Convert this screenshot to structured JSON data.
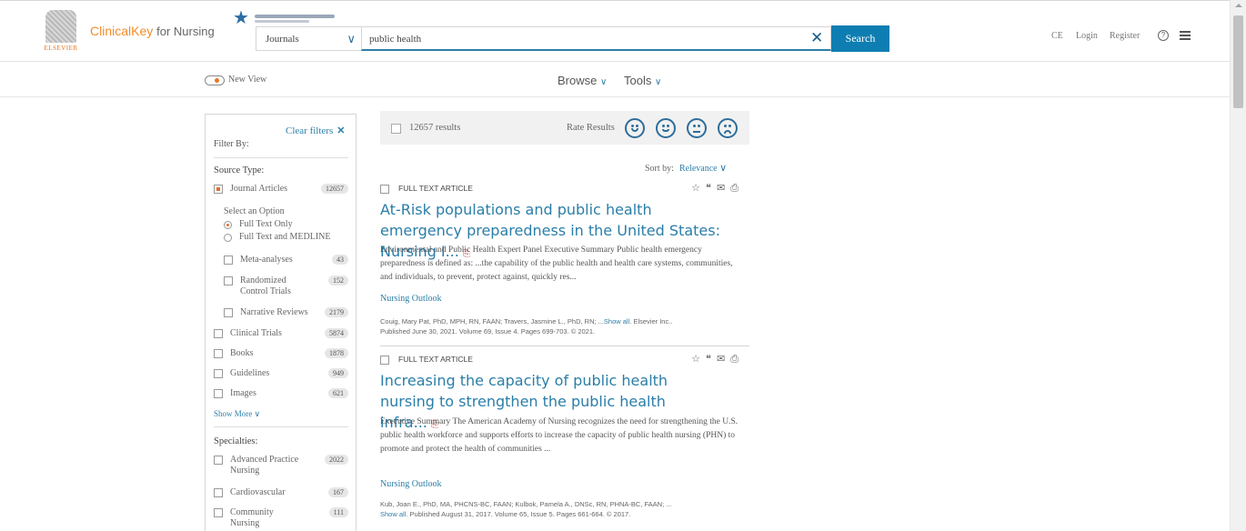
{
  "header": {
    "logo_text": "ELSEVIER",
    "brand_primary": "ClinicalKey",
    "brand_secondary": "for Nursing",
    "search_scope": "Journals",
    "search_query": "public health",
    "search_button": "Search",
    "nav": {
      "ce": "CE",
      "login": "Login",
      "register": "Register"
    }
  },
  "subnav": {
    "new_view": "New View",
    "browse": "Browse",
    "tools": "Tools"
  },
  "filters": {
    "clear_filters": "Clear filters",
    "filter_by": "Filter By:",
    "source_type_title": "Source Type:",
    "journal_articles": {
      "label": "Journal Articles",
      "count": "12657"
    },
    "select_option": "Select an Option",
    "full_text_only": "Full Text Only",
    "full_text_medline": "Full Text and MEDLINE",
    "sub_types": [
      {
        "label": "Meta-analyses",
        "count": "43"
      },
      {
        "label": "Randomized Control Trials",
        "count": "152"
      },
      {
        "label": "Narrative Reviews",
        "count": "2179"
      }
    ],
    "other_types": [
      {
        "label": "Clinical Trials",
        "count": "5874"
      },
      {
        "label": "Books",
        "count": "1878"
      },
      {
        "label": "Guidelines",
        "count": "949"
      },
      {
        "label": "Images",
        "count": "621"
      }
    ],
    "show_more": "Show More",
    "specialties_title": "Specialties:",
    "specialties": [
      {
        "label": "Advanced Practice Nursing",
        "count": "2022"
      },
      {
        "label": "Cardiovascular",
        "count": "167"
      },
      {
        "label": "Community Nursing",
        "count": "111"
      }
    ]
  },
  "results": {
    "count_text": "12657 results",
    "rate_results": "Rate Results",
    "sort_by": "Sort by:",
    "sort_value": "Relevance",
    "articles": [
      {
        "type": "FULL TEXT ARTICLE",
        "title": "At-Risk populations and public health emergency preparedness in the United States: Nursing I...",
        "abstract": "Environmental and Public Health Expert Panel Executive Summary Public health emergency preparedness is defined as: ...the capability of the public health and health care systems, communities, and individuals, to prevent, protect against, quickly res...",
        "journal": "Nursing Outlook",
        "authors": "Couig, Mary Pat, PhD, MPH, RN, FAAN; Travers, Jasmine L., PhD, RN; ...",
        "show_all": "Show all.",
        "pub_info": "Published June 30, 2021. Volume 69, Issue 4. Pages 699-703. © 2021.",
        "publisher": "Elsevier Inc.."
      },
      {
        "type": "FULL TEXT ARTICLE",
        "title": "Increasing the capacity of public health nursing to strengthen the public health infra...",
        "abstract": "Executive Summary The American Academy of Nursing recognizes the need for strengthening the U.S. public health workforce and supports efforts to increase the capacity of public health nursing (PHN) to promote and protect the health of communities ...",
        "journal": "Nursing Outlook",
        "authors": "Kub, Joan E., PhD, MA, PHCNS-BC, FAAN; Kulbok, Pamela A., DNSc, RN, PHNA-BC, FAAN; ...",
        "show_all": "Show all.",
        "pub_info": "Published August 31, 2017. Volume 65, Issue 5. Pages 661-664. © 2017."
      }
    ]
  },
  "colors": {
    "accent": "#0e7eb2",
    "link": "#2a7ea8",
    "brand_orange": "#f28c2a",
    "pdf_red": "#d23b3b"
  }
}
